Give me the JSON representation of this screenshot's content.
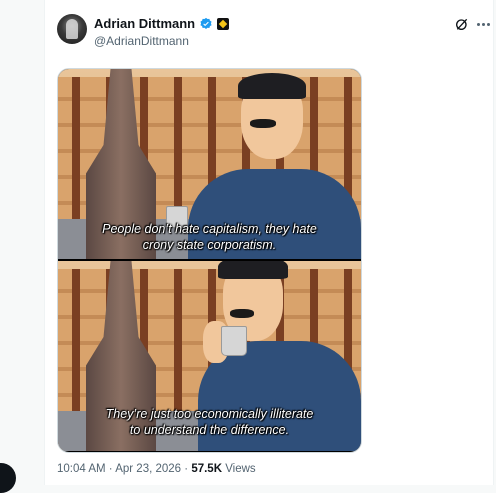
{
  "author": {
    "name": "Adrian Dittmann",
    "handle": "@AdrianDittmann",
    "verified_color": "#1d9bf0"
  },
  "icons": [
    "verified-badge-icon",
    "affiliate-badge-icon",
    "grok-icon",
    "more-icon"
  ],
  "media": {
    "frames": [
      {
        "caption": [
          "People don’t hate capitalism, they hate",
          "crony state corporatism."
        ]
      },
      {
        "caption": [
          "They’re just too economically illiterate",
          "to understand the difference."
        ]
      }
    ]
  },
  "meta": {
    "time": "10:04 AM",
    "separator": "·",
    "date": "Apr 23, 2026",
    "views_count": "57.5K",
    "views_label": "Views"
  }
}
